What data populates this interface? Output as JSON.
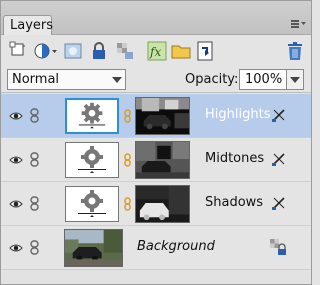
{
  "panel": {
    "tab_label": "Layers",
    "menu_icon": "panel-menu-icon"
  },
  "toolbar": {
    "buttons": [
      {
        "name": "new-layer-icon"
      },
      {
        "name": "new-fill-adjustment-icon"
      },
      {
        "name": "add-layer-mask-icon"
      },
      {
        "name": "lock-all-icon"
      },
      {
        "name": "lock-transparent-icon"
      },
      {
        "name": "layer-style-fx-icon"
      },
      {
        "name": "new-group-icon"
      },
      {
        "name": "clipping-mask-icon"
      },
      {
        "name": "delete-layer-icon"
      }
    ]
  },
  "options": {
    "blend_mode": "Normal",
    "opacity_label": "Opacity:",
    "opacity_value": "100%"
  },
  "layers": [
    {
      "name": "Highlights",
      "selected": true,
      "type": "adjustment"
    },
    {
      "name": "Midtones",
      "selected": false,
      "type": "adjustment"
    },
    {
      "name": "Shadows",
      "selected": false,
      "type": "adjustment"
    },
    {
      "name": "Background",
      "selected": false,
      "type": "background"
    }
  ],
  "colors": {
    "selected_row": "#b7ccea",
    "selection_border": "#2d8fd6",
    "panel_bg": "#e4e4e4",
    "chain_orange": "#e09a1a"
  }
}
